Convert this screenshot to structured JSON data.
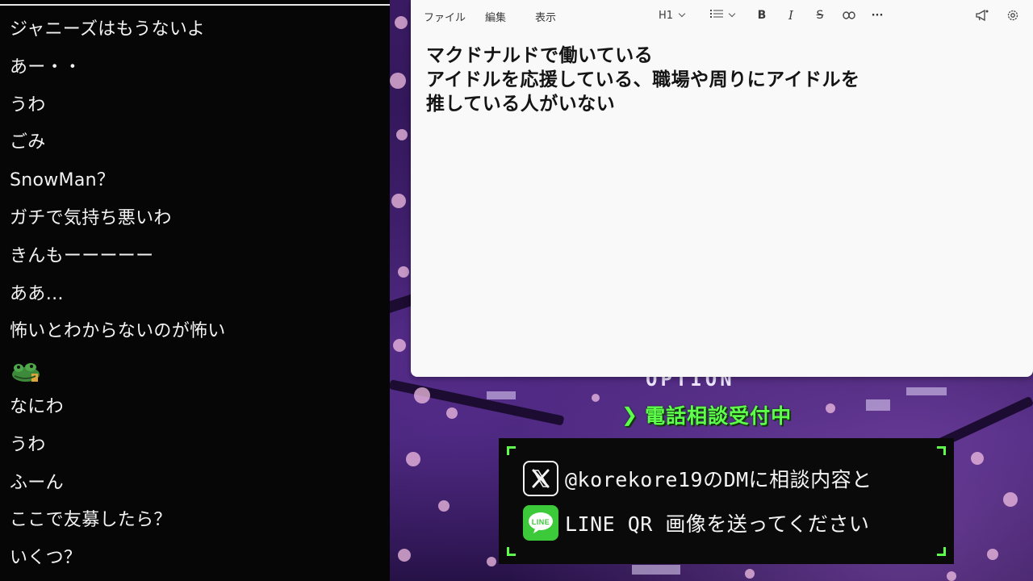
{
  "chat": {
    "messages": [
      "ジャニーズはもうないよ",
      "あー・・",
      "うわ",
      "ごみ",
      "SnowMan？",
      "ガチで気持ち悪いわ",
      "きんもーーーーー",
      "ああ…",
      "怖いとわからないのが怖い",
      "",
      "なにわ",
      "うわ",
      "ふーん",
      "ここで友募したら？",
      "いくつ？"
    ],
    "emote_icon": "frog-emote-icon"
  },
  "notepad": {
    "menu": [
      "ファイル",
      "編集",
      "表示"
    ],
    "heading_label": "H1",
    "icons": [
      "list-icon",
      "bold-icon",
      "italic-icon",
      "strikethrough-icon",
      "link-icon",
      "more-icon",
      "megaphone-icon",
      "settings-icon"
    ],
    "bold_label": "B",
    "italic_label": "I",
    "strike_label": "S",
    "more_label": "···",
    "content_lines": [
      "マクドナルドで働いている",
      "アイドルを応援している、職場や周りにアイドルを",
      "推している人がいない"
    ]
  },
  "overlay": {
    "option_text": "OPTION",
    "phone_text": "電話相談受付中",
    "contact_lines": [
      "@korekore19のDMに相談内容と",
      "LINE QR 画像を送ってください"
    ],
    "contact_icons": [
      "x-logo-icon",
      "line-logo-icon"
    ],
    "line_icon_text": "LINE",
    "accent_color": "#5dff4a"
  }
}
